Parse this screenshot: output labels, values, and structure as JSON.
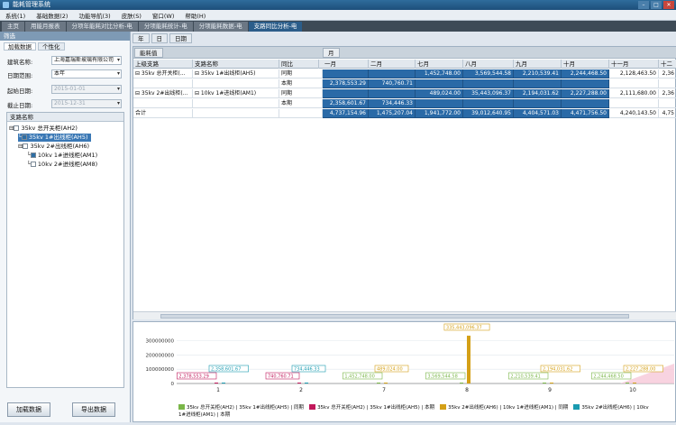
{
  "window": {
    "title": "能耗管理系统"
  },
  "menu": [
    "系统(1)",
    "基础数据(2)",
    "功能导航(3)",
    "皮肤(S)",
    "窗口(W)",
    "帮助(H)"
  ],
  "tabs": [
    {
      "label": "主页"
    },
    {
      "label": "用能月报表"
    },
    {
      "label": "分项年能耗对比分析-电"
    },
    {
      "label": "分项能耗统计-电"
    },
    {
      "label": "分项能耗数据-电"
    },
    {
      "label": "支路同比分析-电"
    }
  ],
  "left": {
    "header": "筛选",
    "tab_load": "加载数据",
    "tab_custom": "个性化",
    "building_label": "建筑名称:",
    "building_value": "上海嘉瑞斯玻璃有限公司",
    "range_label": "日期范围:",
    "range_value": "本年",
    "start_label": "起始日期:",
    "start_value": "2015-01-01",
    "end_label": "截止日期:",
    "end_value": "2015-12-31",
    "tree_header": "支路名称",
    "tree": [
      {
        "label": "35kv 总开关柜(AH2)",
        "checked": false
      },
      {
        "label": "35kv 1#出线柜(AH5)",
        "checked": true
      },
      {
        "label": "35kv 2#出线柜(AH6)",
        "checked": false
      },
      {
        "label": "10kv 1#进线柜(AM1)",
        "checked": true
      },
      {
        "label": "10kv 2#进线柜(AM8)",
        "checked": false
      }
    ],
    "btn_load": "加载数据",
    "btn_export": "导出数据"
  },
  "period_tabs": [
    "年",
    "日",
    "日期"
  ],
  "grid": {
    "label": "能耗值",
    "month_group": "月",
    "col_parent": "上级支路",
    "col_branch": "支路名称",
    "col_compare": "同比",
    "months": [
      "一月",
      "二月",
      "七月",
      "八月",
      "九月",
      "十月",
      "十一月",
      "十二"
    ],
    "rows": [
      {
        "parent": "35kv 总开关柜(...",
        "branch": "35kv 1#出线柜(AH5)",
        "compare": "同期",
        "values": [
          "",
          "",
          "1,452,748.00",
          "3,569,544.58",
          "2,210,539.41",
          "2,244,468.50",
          "2,128,463.50",
          "2,36"
        ]
      },
      {
        "parent": "",
        "branch": "",
        "compare": "本期",
        "values": [
          "2,378,553.29",
          "740,760.71",
          "",
          "",
          "",
          "",
          "",
          ""
        ]
      },
      {
        "parent": "35kv 2#出线柜(...",
        "branch": "10kv 1#进线柜(AM1)",
        "compare": "同期",
        "values": [
          "",
          "",
          "489,024.00",
          "35,443,096.37",
          "2,194,031.62",
          "2,227,288.00",
          "2,111,680.00",
          "2,36"
        ]
      },
      {
        "parent": "",
        "branch": "",
        "compare": "本期",
        "values": [
          "2,358,601.67",
          "734,446.33",
          "",
          "",
          "",
          "",
          "",
          ""
        ]
      }
    ],
    "total_label": "合计",
    "totals": [
      "4,737,154.96",
      "1,475,207.04",
      "1,941,772.00",
      "39,012,640.95",
      "4,404,571.03",
      "4,471,756.50",
      "4,240,143.50",
      "4,75"
    ]
  },
  "chart_data": {
    "type": "bar",
    "categories": [
      "1",
      "2",
      "7",
      "8",
      "9",
      "10"
    ],
    "y_ticks": [
      "0",
      "100000000",
      "200000000",
      "300000000"
    ],
    "ylim": [
      0,
      380000000
    ],
    "series": [
      {
        "name": "35kv 总开关柜(AH2) | 35kv 1#出线柜(AH5) | 同期",
        "color": "#7ab648",
        "values": [
          0,
          0,
          1452748.0,
          3569544.58,
          2210539.41,
          2244468.5
        ]
      },
      {
        "name": "35kv 总开关柜(AH2) | 35kv 1#出线柜(AH5) | 本期",
        "color": "#c2185b",
        "values": [
          2378553.29,
          740760.71,
          0,
          0,
          0,
          0
        ]
      },
      {
        "name": "35kv 2#出线柜(AH6) | 10kv 1#进线柜(AM1) | 同期",
        "color": "#d4a017",
        "values": [
          0,
          0,
          489024.0,
          335443096.37,
          2194031.62,
          2227288.0
        ]
      },
      {
        "name": "35kv 2#出线柜(AH6) | 10kv 1#进线柜(AM1) | 本期",
        "color": "#1a9bb0",
        "values": [
          2358601.67,
          734446.33,
          0,
          0,
          0,
          0
        ]
      }
    ],
    "point_labels": [
      {
        "text": "2,378,553.29",
        "color": "#c2185b"
      },
      {
        "text": "2,358,601.67",
        "color": "#1a9bb0"
      },
      {
        "text": "740,760.71",
        "color": "#c2185b"
      },
      {
        "text": "734,446.33",
        "color": "#1a9bb0"
      },
      {
        "text": "1,452,748.00",
        "color": "#7ab648"
      },
      {
        "text": "489,024.00",
        "color": "#d4a017"
      },
      {
        "text": "3,569,544.58",
        "color": "#7ab648"
      },
      {
        "text": "335,443,096.37",
        "color": "#d4a017"
      },
      {
        "text": "2,210,539.41",
        "color": "#7ab648"
      },
      {
        "text": "2,194,031.62",
        "color": "#d4a017"
      },
      {
        "text": "2,244,468.50",
        "color": "#7ab648"
      },
      {
        "text": "2,227,288.00",
        "color": "#d4a017"
      }
    ]
  }
}
